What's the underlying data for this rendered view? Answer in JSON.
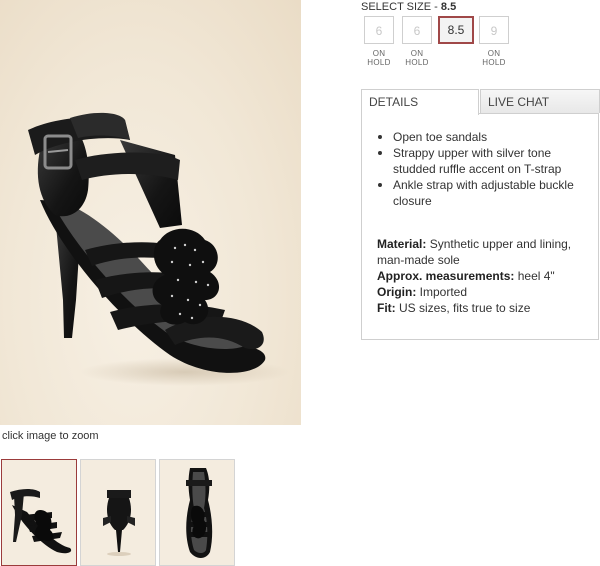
{
  "product_image": {
    "zoom_caption": "click image to zoom"
  },
  "thumbnails": [
    {
      "id": "thumb-1",
      "view": "angled",
      "selected": true
    },
    {
      "id": "thumb-2",
      "view": "back",
      "selected": false
    },
    {
      "id": "thumb-3",
      "view": "top",
      "selected": false
    }
  ],
  "size_selector": {
    "label": "SELECT SIZE -",
    "selected_value": "8.5",
    "options": [
      {
        "value": "6",
        "status": "ON\nHOLD",
        "selected": false
      },
      {
        "value": "6",
        "status": "ON\nHOLD",
        "selected": false
      },
      {
        "value": "8.5",
        "status": "",
        "selected": true
      },
      {
        "value": "9",
        "status": "ON\nHOLD",
        "selected": false
      }
    ]
  },
  "tabs": [
    {
      "label": "DETAILS",
      "active": true
    },
    {
      "label": "LIVE CHAT",
      "active": false
    }
  ],
  "details": {
    "bullets": [
      "Open toe sandals",
      "Strappy upper with silver tone studded ruffle accent on T-strap",
      "Ankle strap with adjustable buckle closure"
    ],
    "specs": {
      "material_label": "Material:",
      "material_value": "Synthetic upper and lining, man-made sole",
      "measurements_label": "Approx. measurements:",
      "measurements_value": "heel 4\"",
      "origin_label": "Origin:",
      "origin_value": "Imported",
      "fit_label": "Fit:",
      "fit_value": "US sizes, fits true to size"
    }
  },
  "colors": {
    "selected_border": "#a04848",
    "product_background": "#f1e7d6",
    "shoe": "#1a1a1a"
  }
}
